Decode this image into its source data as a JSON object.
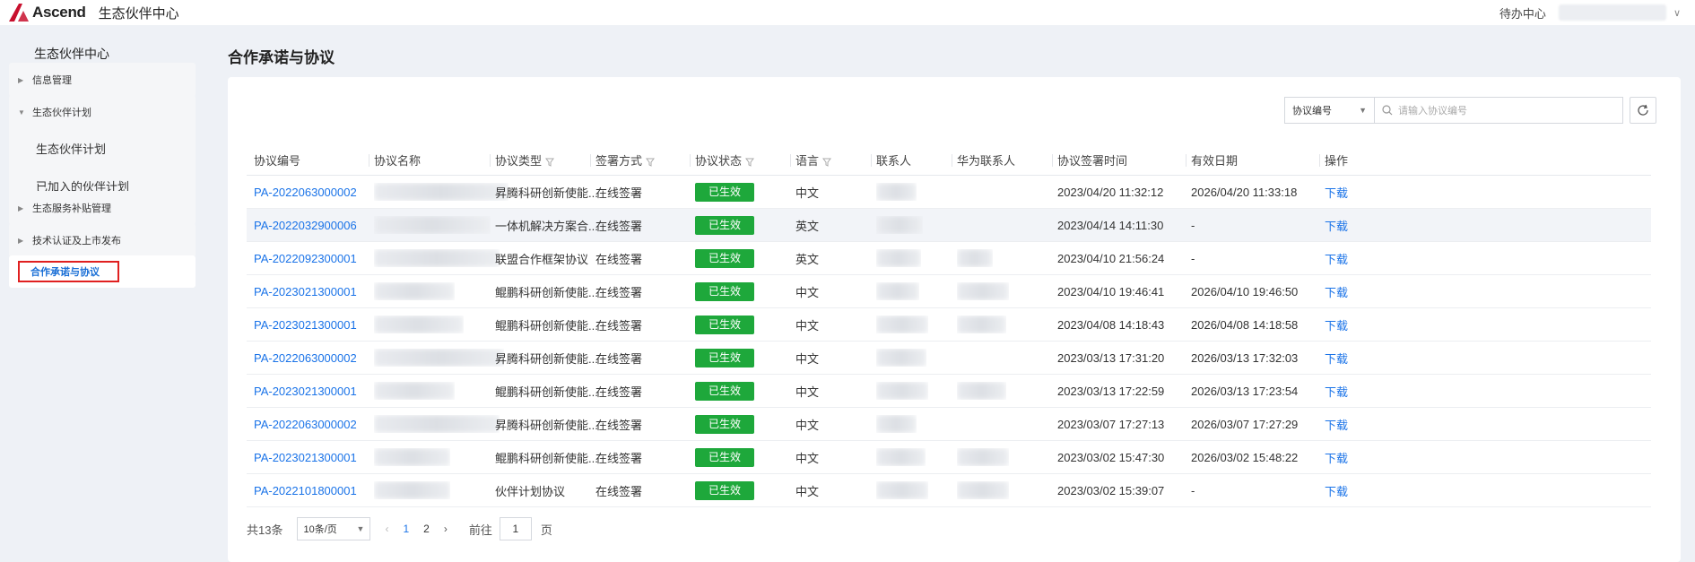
{
  "topbar": {
    "logo_text": "Ascend",
    "app_title": "生态伙伴中心",
    "todo_label": "待办中心",
    "chevron": "∨",
    "accent_color": "#c8102e"
  },
  "sidebar": {
    "title": "生态伙伴中心",
    "groups": [
      {
        "label": "信息管理"
      },
      {
        "label": "生态伙伴计划",
        "children": [
          {
            "label": "生态伙伴计划"
          },
          {
            "label": "已加入的伙伴计划"
          }
        ]
      },
      {
        "label": "生态服务补贴管理"
      },
      {
        "label": "技术认证及上市发布"
      }
    ],
    "active_item": "合作承诺与协议"
  },
  "page": {
    "title": "合作承诺与协议"
  },
  "search": {
    "select_label": "协议编号",
    "placeholder": "请输入协议编号"
  },
  "table": {
    "headers": [
      "协议编号",
      "协议名称",
      "协议类型",
      "签署方式",
      "协议状态",
      "语言",
      "联系人",
      "华为联系人",
      "协议签署时间",
      "有效日期",
      "操作"
    ],
    "rows": [
      {
        "id": "PA-2022063000002",
        "type": "昇腾科研创新使能...",
        "method": "在线签署",
        "status": "已生效",
        "lang": "中文",
        "sign_time": "2023/04/20 11:32:12",
        "valid": "2026/04/20 11:33:18",
        "action": "下载"
      },
      {
        "id": "PA-2022032900006",
        "type": "一体机解决方案合...",
        "method": "在线签署",
        "status": "已生效",
        "lang": "英文",
        "sign_time": "2023/04/14 14:11:30",
        "valid": "-",
        "action": "下载"
      },
      {
        "id": "PA-2022092300001",
        "type": "联盟合作框架协议",
        "method": "在线签署",
        "status": "已生效",
        "lang": "英文",
        "sign_time": "2023/04/10 21:56:24",
        "valid": "-",
        "action": "下载"
      },
      {
        "id": "PA-2023021300001",
        "type": "鲲鹏科研创新使能...",
        "method": "在线签署",
        "status": "已生效",
        "lang": "中文",
        "sign_time": "2023/04/10 19:46:41",
        "valid": "2026/04/10 19:46:50",
        "action": "下载"
      },
      {
        "id": "PA-2023021300001",
        "type": "鲲鹏科研创新使能...",
        "method": "在线签署",
        "status": "已生效",
        "lang": "中文",
        "sign_time": "2023/04/08 14:18:43",
        "valid": "2026/04/08 14:18:58",
        "action": "下载"
      },
      {
        "id": "PA-2022063000002",
        "type": "昇腾科研创新使能...",
        "method": "在线签署",
        "status": "已生效",
        "lang": "中文",
        "sign_time": "2023/03/13 17:31:20",
        "valid": "2026/03/13 17:32:03",
        "action": "下载"
      },
      {
        "id": "PA-2023021300001",
        "type": "鲲鹏科研创新使能...",
        "method": "在线签署",
        "status": "已生效",
        "lang": "中文",
        "sign_time": "2023/03/13 17:22:59",
        "valid": "2026/03/13 17:23:54",
        "action": "下载"
      },
      {
        "id": "PA-2022063000002",
        "type": "昇腾科研创新使能...",
        "method": "在线签署",
        "status": "已生效",
        "lang": "中文",
        "sign_time": "2023/03/07 17:27:13",
        "valid": "2026/03/07 17:27:29",
        "action": "下载"
      },
      {
        "id": "PA-2023021300001",
        "type": "鲲鹏科研创新使能...",
        "method": "在线签署",
        "status": "已生效",
        "lang": "中文",
        "sign_time": "2023/03/02 15:47:30",
        "valid": "2026/03/02 15:48:22",
        "action": "下载"
      },
      {
        "id": "PA-2022101800001",
        "type": "伙伴计划协议",
        "method": "在线签署",
        "status": "已生效",
        "lang": "中文",
        "sign_time": "2023/03/02 15:39:07",
        "valid": "-",
        "action": "下载"
      }
    ],
    "status_color": "#1ea83b",
    "link_color": "#1a73e8"
  },
  "pagination": {
    "total": "共13条",
    "page_size": "10条/页",
    "prev": "‹",
    "next": "›",
    "pages": [
      "1",
      "2"
    ],
    "goto_label": "前往",
    "goto_value": "1",
    "page_unit": "页"
  }
}
